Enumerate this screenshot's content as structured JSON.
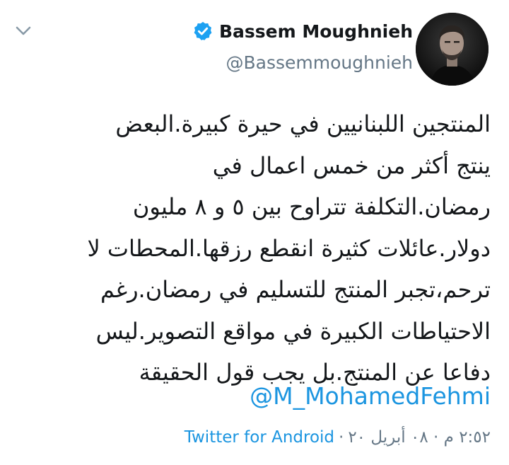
{
  "tweet": {
    "author": {
      "display_name": "Bassem Moughnieh",
      "handle": "@Bassemmoughnieh",
      "verified": true,
      "verified_icon": "verified-badge-icon",
      "avatar": "author-avatar"
    },
    "menu_icon": "chevron-down-icon",
    "text_lines": [
      "المنتجين اللبنانيين في حيرة كبيرة.البعض",
      "ينتج أكثر من خمس اعمال في",
      "رمضان.التكلفة تتراوح بين ٥ و ٨ مليون",
      "دولار.عائلات كثيرة انقطع رزقها.المحطات لا",
      "ترحم،تجبر المنتج للتسليم في رمضان.رغم",
      "الاحتياطات الكبيرة في مواقع التصوير.ليس",
      "دفاعا عن المنتج.بل يجب قول الحقيقة"
    ],
    "mention": "@M_MohamedFehmi",
    "timestamp": "٢:٥٢ م · ٠٨ أبريل ٢٠",
    "separator": "·",
    "source": "Twitter for Android"
  },
  "colors": {
    "text": "#14171a",
    "secondary": "#657786",
    "link": "#1b95e0",
    "verified": "#1da1f2"
  }
}
